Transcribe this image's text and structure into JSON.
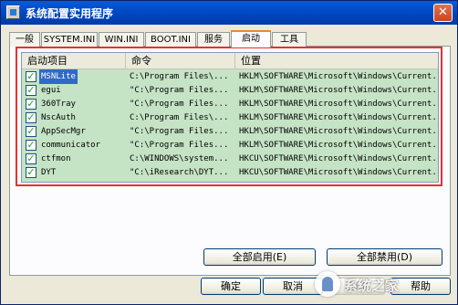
{
  "window": {
    "title": "系统配置实用程序",
    "close_glyph": "✕"
  },
  "tabs": [
    "一般",
    "SYSTEM.INI",
    "WIN.INI",
    "BOOT.INI",
    "服务",
    "启动",
    "工具"
  ],
  "list": {
    "columns": [
      "启动项目",
      "命令",
      "位置"
    ],
    "rows": [
      {
        "name": "MSNLite",
        "command": "C:\\Program Files\\...",
        "location": "HKLM\\SOFTWARE\\Microsoft\\Windows\\Current...",
        "checked": true,
        "selected": true
      },
      {
        "name": "egui",
        "command": "\"C:\\Program Files...",
        "location": "HKLM\\SOFTWARE\\Microsoft\\Windows\\Current...",
        "checked": true
      },
      {
        "name": "360Tray",
        "command": "\"C:\\Program Files...",
        "location": "HKLM\\SOFTWARE\\Microsoft\\Windows\\Current...",
        "checked": true
      },
      {
        "name": "NscAuth",
        "command": "C:\\Program Files\\...",
        "location": "HKLM\\SOFTWARE\\Microsoft\\Windows\\Current...",
        "checked": true
      },
      {
        "name": "AppSecMgr",
        "command": "\"C:\\Program Files...",
        "location": "HKLM\\SOFTWARE\\Microsoft\\Windows\\Current...",
        "checked": true
      },
      {
        "name": "communicator",
        "command": "\"C:\\Program Files...",
        "location": "HKLM\\SOFTWARE\\Microsoft\\Windows\\Current...",
        "checked": true
      },
      {
        "name": "ctfmon",
        "command": "C:\\WINDOWS\\system...",
        "location": "HKCU\\SOFTWARE\\Microsoft\\Windows\\Current...",
        "checked": true
      },
      {
        "name": "DYT",
        "command": "\"C:\\iResearch\\DYT...",
        "location": "HKCU\\SOFTWARE\\Microsoft\\Windows\\Current...",
        "checked": true
      }
    ],
    "check_glyph": "✓"
  },
  "buttons": {
    "enable_all": "全部启用(E)",
    "disable_all": "全部禁用(D)",
    "ok": "确定",
    "cancel": "取消",
    "apply": "应用",
    "help": "帮助"
  },
  "watermark": {
    "text": "系统之家"
  },
  "colors": {
    "list_bg": "#c5e3c5",
    "highlight_border": "#e23333",
    "tab_accent": "#e68b2c"
  }
}
